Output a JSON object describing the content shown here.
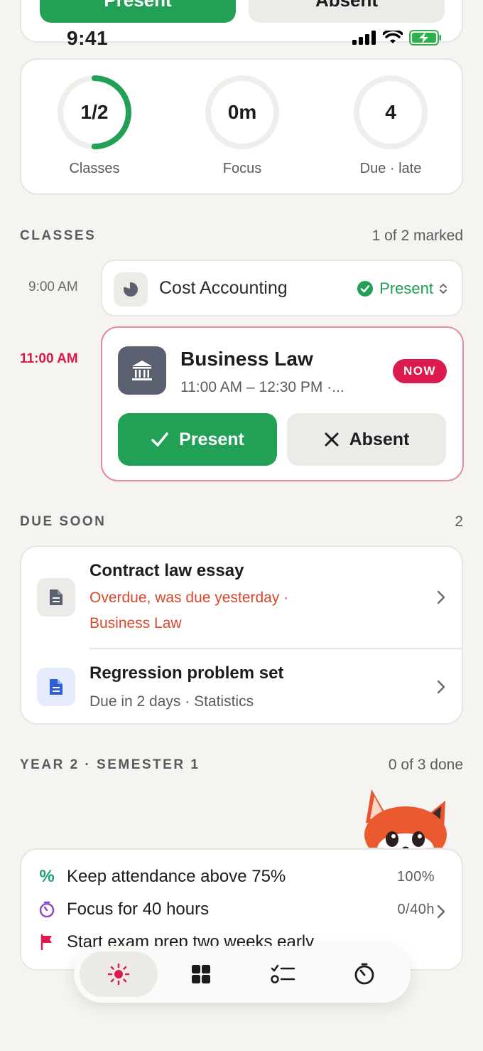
{
  "top_partial": {
    "present_label": "Present",
    "absent_label": "Absent"
  },
  "status_bar": {
    "time": "9:41"
  },
  "stats": [
    {
      "value": "1/2",
      "label": "Classes",
      "progress": 0.5
    },
    {
      "value": "0m",
      "label": "Focus",
      "progress": 0
    },
    {
      "value": "4",
      "label": "Due · late",
      "progress": 0
    }
  ],
  "classes": {
    "title": "CLASSES",
    "meta": "1 of 2 marked",
    "items": [
      {
        "time": "9:00 AM",
        "name": "Cost Accounting",
        "status": "Present"
      },
      {
        "time": "11:00 AM",
        "name": "Business Law",
        "range": "11:00 AM – 12:30 PM ·...",
        "badge": "NOW",
        "present_label": "Present",
        "absent_label": "Absent"
      }
    ]
  },
  "due_soon": {
    "title": "DUE SOON",
    "count": "2",
    "items": [
      {
        "title": "Contract law essay",
        "line1": "Overdue, was due yesterday ·",
        "line2": "Business Law",
        "status_color": "#d9482b"
      },
      {
        "title": "Regression problem set",
        "line1": "Due in 2 days · Statistics"
      }
    ]
  },
  "semester": {
    "title": "YEAR 2 · SEMESTER 1",
    "meta": "0 of 3 done",
    "goals": [
      {
        "text": "Keep attendance above 75%",
        "value": "100%",
        "icon": "percent-icon"
      },
      {
        "text": "Focus for 40 hours",
        "value": "0/40h",
        "icon": "timer-icon"
      },
      {
        "text": "Start exam prep two weeks early",
        "value": "",
        "icon": "flag-icon"
      }
    ]
  },
  "tabs": [
    {
      "icon": "sun-icon",
      "active": true
    },
    {
      "icon": "grid-icon",
      "active": false
    },
    {
      "icon": "checklist-icon",
      "active": false
    },
    {
      "icon": "stopwatch-icon",
      "active": false
    }
  ],
  "colors": {
    "green": "#22a055",
    "red": "#dc1a4c",
    "accent_border": "#e58aa0",
    "background": "#f5f4f1"
  }
}
